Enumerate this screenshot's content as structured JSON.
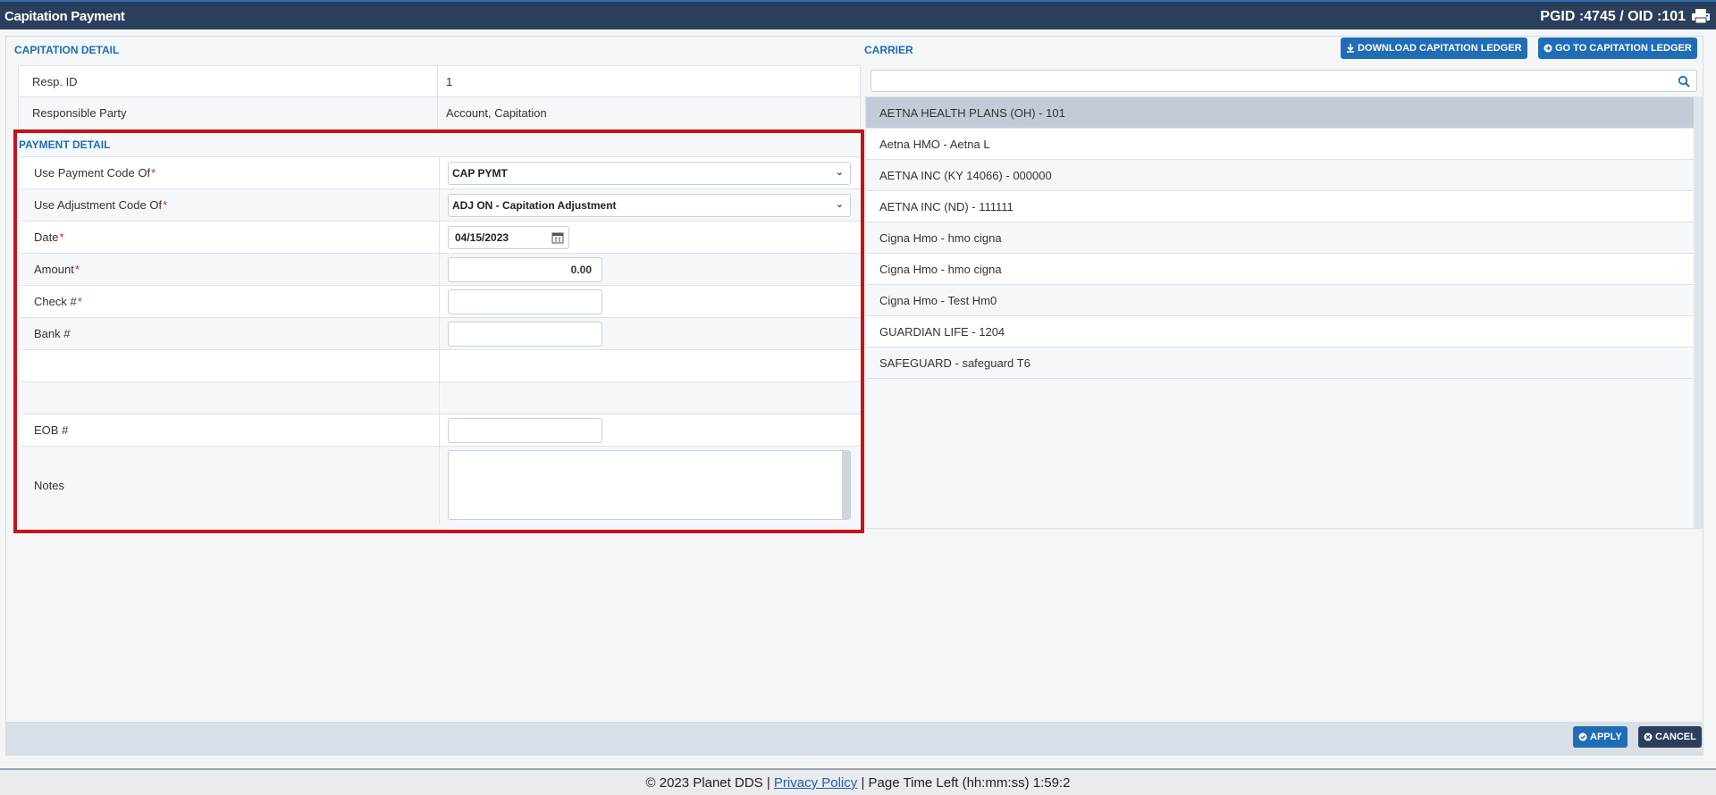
{
  "header": {
    "title": "Capitation Payment",
    "ids": "PGID :4745  /  OID :101"
  },
  "capitation": {
    "section_title": "CAPITATION DETAIL",
    "resp_id_label": "Resp. ID",
    "resp_id_value": "1",
    "resp_party_label": "Responsible Party",
    "resp_party_value": "Account, Capitation"
  },
  "payment": {
    "section_title": "PAYMENT DETAIL",
    "payment_code_label": "Use Payment Code Of",
    "payment_code_value": "CAP PYMT",
    "adjustment_code_label": "Use Adjustment Code Of",
    "adjustment_code_value": "ADJ ON - Capitation Adjustment",
    "date_label": "Date",
    "date_value": "04/15/2023",
    "amount_label": "Amount",
    "amount_value": "0.00",
    "check_label": "Check #",
    "check_value": "",
    "bank_label": "Bank #",
    "bank_value": "",
    "eob_label": "EOB #",
    "eob_value": "",
    "notes_label": "Notes",
    "required_mark": "*"
  },
  "carrier": {
    "section_title": "CARRIER",
    "download_button": "DOWNLOAD CAPITATION LEDGER",
    "goto_button": "GO TO CAPITATION LEDGER",
    "search_value": "",
    "items": [
      "AETNA HEALTH PLANS (OH) - 101",
      "Aetna HMO - Aetna L",
      "AETNA INC (KY 14066) - 000000",
      "AETNA INC (ND) - 111111",
      "Cigna Hmo - hmo cigna",
      "Cigna Hmo - hmo cigna",
      "Cigna Hmo - Test Hm0",
      "GUARDIAN LIFE - 1204",
      "SAFEGUARD - safeguard T6"
    ],
    "selected_index": 0
  },
  "actions": {
    "apply_label": "APPLY",
    "cancel_label": "CANCEL"
  },
  "footer": {
    "copyright": "© 2023 Planet DDS |",
    "privacy_link": "Privacy Policy",
    "separator": "|",
    "time_left": "Page Time Left (hh:mm:ss) 1:59:2"
  },
  "colors": {
    "titlebar": "#2b3f5c",
    "accent": "#1f6db5",
    "highlight_border": "#c4141b",
    "cancel_button": "#2b3f5c"
  },
  "icons": {
    "print": "printer-icon",
    "calendar": "calendar-icon",
    "search": "search-icon",
    "download": "download-icon",
    "goto": "arrow-circle-icon",
    "apply": "check-circle-icon",
    "cancel": "times-circle-icon"
  }
}
